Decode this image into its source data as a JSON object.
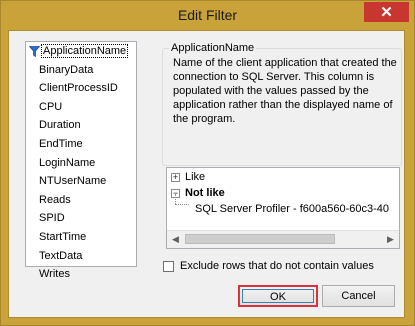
{
  "window": {
    "title": "Edit Filter",
    "close_glyph": "✕"
  },
  "columns": [
    "ApplicationName",
    "BinaryData",
    "ClientProcessID",
    "CPU",
    "Duration",
    "EndTime",
    "LoginName",
    "NTUserName",
    "Reads",
    "SPID",
    "StartTime",
    "TextData",
    "Writes"
  ],
  "selected_column": "ApplicationName",
  "description": {
    "title": "ApplicationName",
    "text": "Name of the client application that created the connection to SQL Server. This column is populated with the values passed by the application rather than the displayed name of the program."
  },
  "criteria": {
    "like_label": "Like",
    "not_like_label": "Not like",
    "not_like_value": "SQL Server Profiler - f600a560-60c3-40"
  },
  "exclude_rows_label": "Exclude rows that do not contain values",
  "exclude_rows_checked": false,
  "buttons": {
    "ok": "OK",
    "cancel": "Cancel"
  },
  "colors": {
    "frame": "#c9a23a",
    "close": "#c7372f",
    "highlight": "#d9343e",
    "filter_icon": "#2a6fcf"
  },
  "icons": {
    "filter": "funnel-icon",
    "close": "close-icon"
  }
}
